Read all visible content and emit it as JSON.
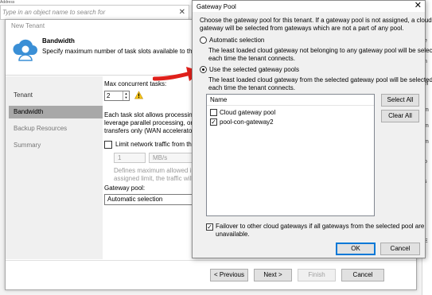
{
  "background": {
    "search_placeholder": "Type in an object name to search for",
    "top_text": "Address",
    "right_letters": [
      "e",
      "n",
      "el",
      "m",
      "m",
      "m",
      "o",
      "s",
      "i",
      "E"
    ]
  },
  "wizard": {
    "window_title": "New Tenant",
    "header_title": "Bandwidth",
    "header_subtitle": "Specify maximum number of task slots available to this ten",
    "sidebar": [
      "Tenant",
      "Bandwidth",
      "Backup Resources",
      "Summary"
    ],
    "active_step": "Bandwidth",
    "max_tasks_label": "Max concurrent tasks:",
    "max_tasks_value": "2",
    "task_slot_text": "Each task slot allows processing o\nleverage parallel processing, or ru\ntransfers only (WAN accelerators",
    "limit_network_label": "Limit network traffic from this",
    "limit_network_checked": false,
    "limit_value": "1",
    "limit_unit": "MB/s",
    "limit_help": "Defines maximum allowed in\nassigned limit, the traffic will l",
    "gateway_pool_label": "Gateway pool:",
    "gateway_pool_value": "Automatic selection",
    "buttons": {
      "previous": "< Previous",
      "next": "Next >",
      "finish": "Finish",
      "cancel": "Cancel"
    }
  },
  "dialog": {
    "title": "Gateway Pool",
    "close_glyph": "✕",
    "description": "Choose the gateway pool for this tenant. If a gateway pool is not assigned, a cloud\ngateway will be selected from gateways which are not a part of any pool.",
    "option_auto": {
      "label": "Automatic selection",
      "desc": "The least loaded cloud gateway not belonging to any gateway pool will be selected\neach time the tenant connects.",
      "selected": false
    },
    "option_selected": {
      "label": "Use the selected gateway pools",
      "desc": "The least loaded cloud gateway from the selected gateway pool will be selected\neach time the tenant connects.",
      "selected": true
    },
    "list_header": "Name",
    "pools": [
      {
        "name": "Cloud gateway pool",
        "checked": false
      },
      {
        "name": "pool-con-gateway2",
        "checked": true
      }
    ],
    "select_all": "Select All",
    "clear_all": "Clear All",
    "failover_text": "Failover to other cloud gateways if all gateways from the selected pool are\nunavailable.",
    "failover_checked": true,
    "ok": "OK",
    "cancel": "Cancel"
  },
  "colors": {
    "arrow": "#e0201b",
    "active_step_bg": "#a8a8a8",
    "ok_border": "#0078d7"
  }
}
